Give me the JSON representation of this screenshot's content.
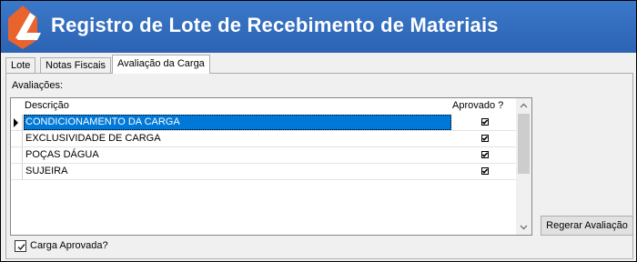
{
  "window": {
    "title": "Registro de Lote de Recebimento de Materiais"
  },
  "tabs": [
    {
      "label": "Lote",
      "active": false
    },
    {
      "label": "Notas Fiscais",
      "active": false
    },
    {
      "label": "Avaliação da Carga",
      "active": true
    }
  ],
  "evaluations": {
    "label": "Avaliações:",
    "columns": {
      "description": "Descrição",
      "approved": "Aprovado ?"
    },
    "rows": [
      {
        "description": "CONDICIONAMENTO DA CARGA",
        "approved": true,
        "selected": true
      },
      {
        "description": "EXCLUSIVIDADE DE CARGA",
        "approved": true,
        "selected": false
      },
      {
        "description": "POÇAS DÁGUA",
        "approved": true,
        "selected": false
      },
      {
        "description": "SUJEIRA",
        "approved": true,
        "selected": false
      }
    ]
  },
  "actions": {
    "regenerate_label": "Regerar Avaliação"
  },
  "cargo_approved": {
    "label": "Carga Aprovada?",
    "checked": true
  },
  "colors": {
    "header_blue": "#2c63b3",
    "selection_blue": "#0078d7",
    "logo_orange": "#e8642c"
  },
  "icons": {
    "logo": "app-logo-icon",
    "row_pointer": "row-pointer-icon",
    "scroll_up": "chevron-up-icon",
    "scroll_down": "chevron-down-icon"
  }
}
